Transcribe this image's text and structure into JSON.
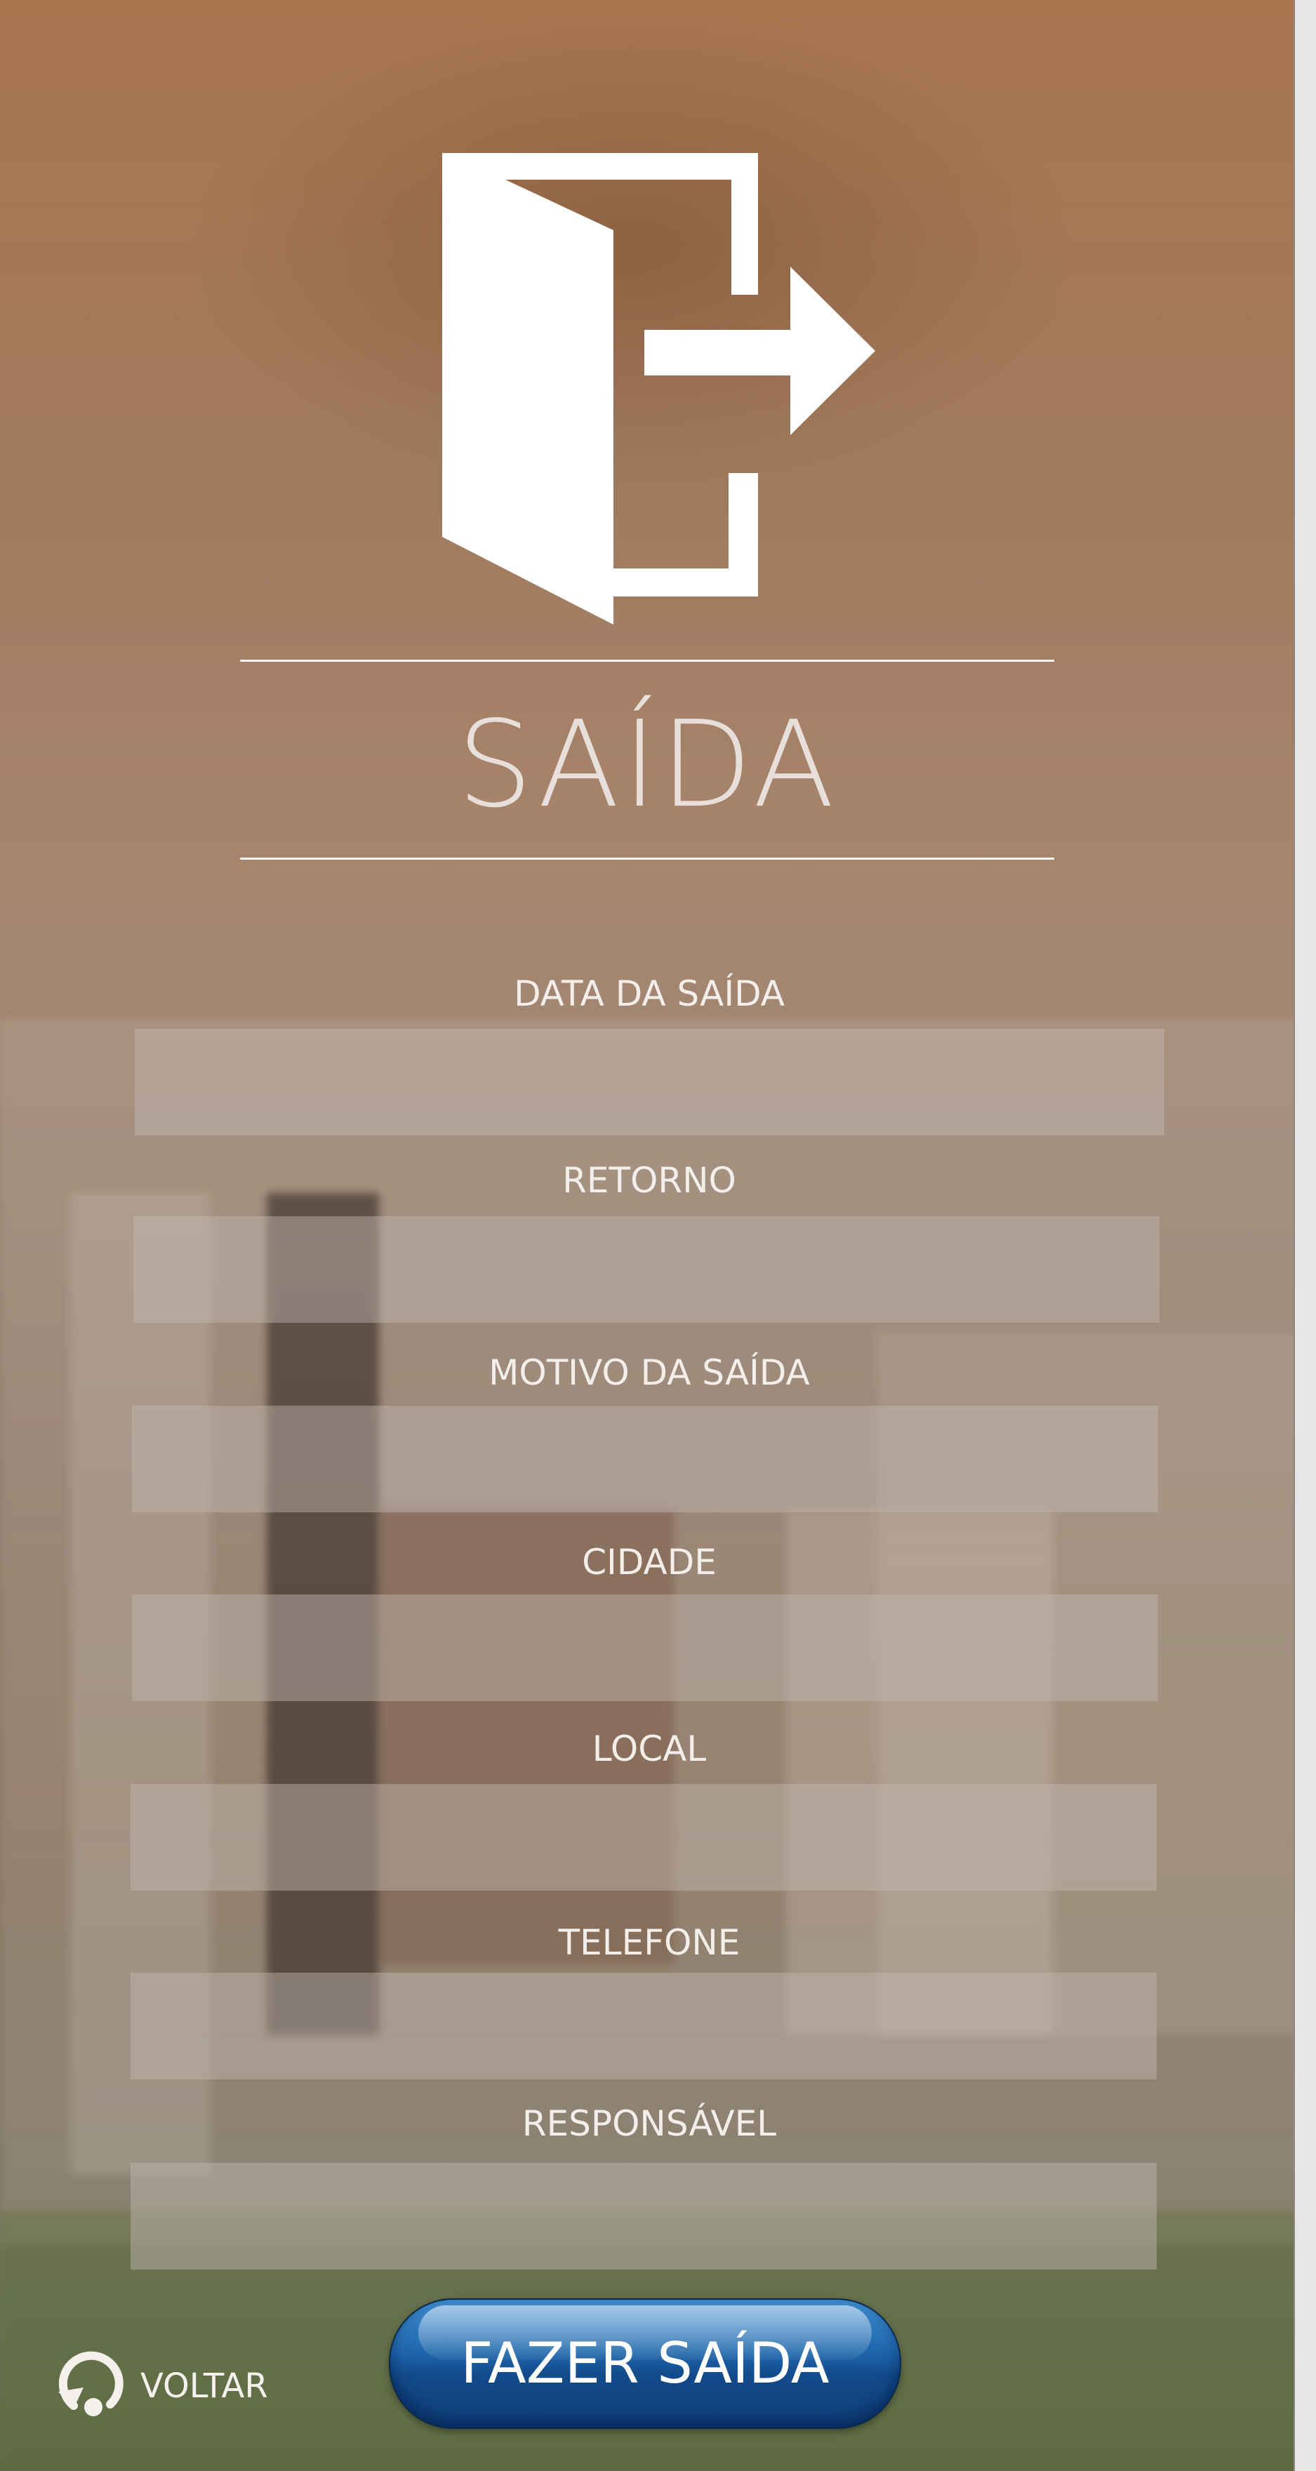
{
  "page": {
    "title": "SAÍDA",
    "logo_icon": "exit-door-arrow-icon"
  },
  "form": {
    "fields": [
      {
        "label": "DATA DA SAÍDA",
        "value": "",
        "placeholder": ""
      },
      {
        "label": "RETORNO",
        "value": "",
        "placeholder": ""
      },
      {
        "label": "MOTIVO DA SAÍDA",
        "value": "",
        "placeholder": ""
      },
      {
        "label": "CIDADE",
        "value": "",
        "placeholder": ""
      },
      {
        "label": "LOCAL",
        "value": "",
        "placeholder": ""
      },
      {
        "label": "TELEFONE",
        "value": "",
        "placeholder": ""
      },
      {
        "label": "RESPONSÁVEL",
        "value": "",
        "placeholder": ""
      }
    ],
    "submit_label": "FAZER SAÍDA"
  },
  "nav": {
    "back_label": "VOLTAR",
    "back_icon": "back-circular-arrow-icon"
  },
  "colors": {
    "submit_button": "#1f67ad",
    "text": "#ffffff"
  }
}
